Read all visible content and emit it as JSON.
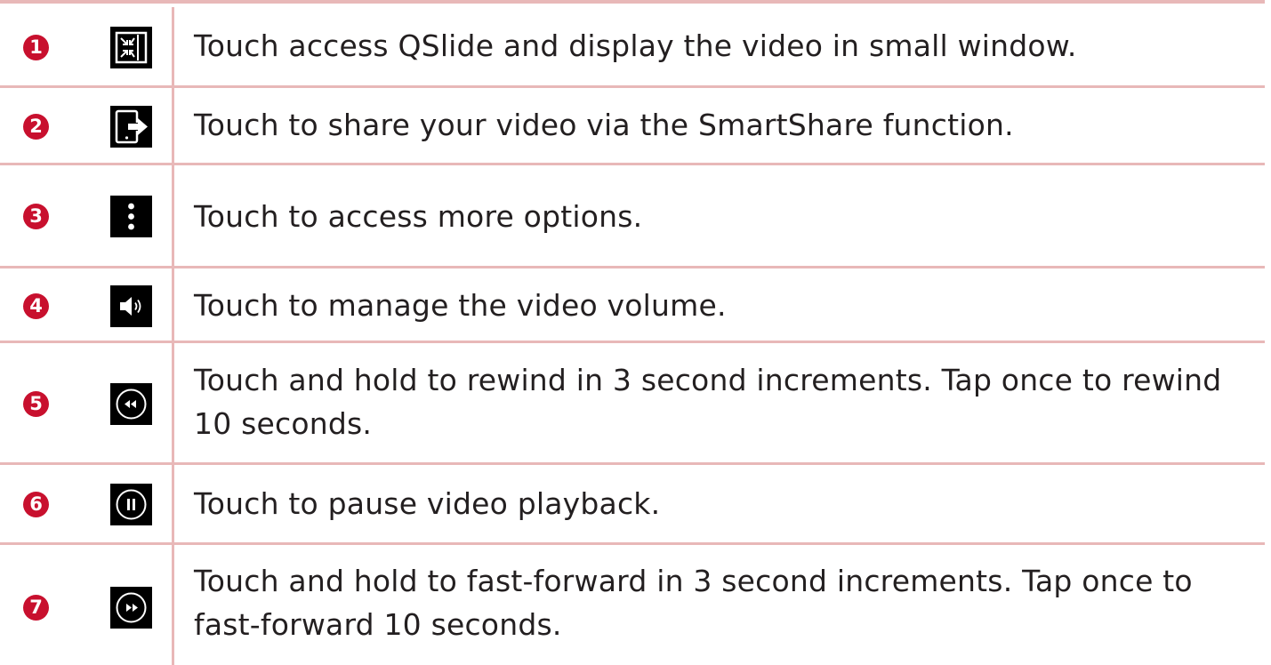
{
  "rows": [
    {
      "number": "1",
      "icon": "qslide-icon",
      "text": "Touch access QSlide and display the video in small window."
    },
    {
      "number": "2",
      "icon": "smartshare-icon",
      "text": "Touch to share your video via the SmartShare function."
    },
    {
      "number": "3",
      "icon": "more-options-icon",
      "text": "Touch to access more options."
    },
    {
      "number": "4",
      "icon": "volume-icon",
      "text": "Touch to manage the video volume."
    },
    {
      "number": "5",
      "icon": "rewind-icon",
      "text": "Touch and hold to rewind in 3 second increments. Tap once to rewind 10 seconds."
    },
    {
      "number": "6",
      "icon": "pause-icon",
      "text": "Touch to pause video playback."
    },
    {
      "number": "7",
      "icon": "fast-forward-icon",
      "text": "Touch and hold to fast-forward in 3 second increments. Tap once to fast-forward 10 seconds."
    }
  ],
  "colors": {
    "rule": "#e8b8b8",
    "badge": "#c8102e",
    "text": "#231f20"
  }
}
